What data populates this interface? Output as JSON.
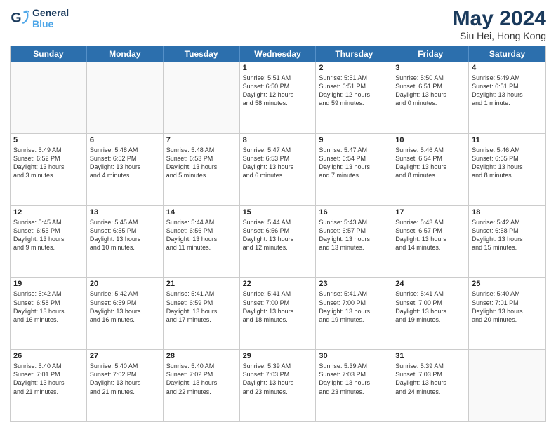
{
  "logo": {
    "line1": "General",
    "line2": "Blue"
  },
  "title": "May 2024",
  "subtitle": "Siu Hei, Hong Kong",
  "days_of_week": [
    "Sunday",
    "Monday",
    "Tuesday",
    "Wednesday",
    "Thursday",
    "Friday",
    "Saturday"
  ],
  "weeks": [
    [
      {
        "day": "",
        "empty": true
      },
      {
        "day": "",
        "empty": true
      },
      {
        "day": "",
        "empty": true
      },
      {
        "day": "1",
        "lines": [
          "Sunrise: 5:51 AM",
          "Sunset: 6:50 PM",
          "Daylight: 12 hours",
          "and 58 minutes."
        ]
      },
      {
        "day": "2",
        "lines": [
          "Sunrise: 5:51 AM",
          "Sunset: 6:51 PM",
          "Daylight: 12 hours",
          "and 59 minutes."
        ]
      },
      {
        "day": "3",
        "lines": [
          "Sunrise: 5:50 AM",
          "Sunset: 6:51 PM",
          "Daylight: 13 hours",
          "and 0 minutes."
        ]
      },
      {
        "day": "4",
        "lines": [
          "Sunrise: 5:49 AM",
          "Sunset: 6:51 PM",
          "Daylight: 13 hours",
          "and 1 minute."
        ]
      }
    ],
    [
      {
        "day": "5",
        "lines": [
          "Sunrise: 5:49 AM",
          "Sunset: 6:52 PM",
          "Daylight: 13 hours",
          "and 3 minutes."
        ]
      },
      {
        "day": "6",
        "lines": [
          "Sunrise: 5:48 AM",
          "Sunset: 6:52 PM",
          "Daylight: 13 hours",
          "and 4 minutes."
        ]
      },
      {
        "day": "7",
        "lines": [
          "Sunrise: 5:48 AM",
          "Sunset: 6:53 PM",
          "Daylight: 13 hours",
          "and 5 minutes."
        ]
      },
      {
        "day": "8",
        "lines": [
          "Sunrise: 5:47 AM",
          "Sunset: 6:53 PM",
          "Daylight: 13 hours",
          "and 6 minutes."
        ]
      },
      {
        "day": "9",
        "lines": [
          "Sunrise: 5:47 AM",
          "Sunset: 6:54 PM",
          "Daylight: 13 hours",
          "and 7 minutes."
        ]
      },
      {
        "day": "10",
        "lines": [
          "Sunrise: 5:46 AM",
          "Sunset: 6:54 PM",
          "Daylight: 13 hours",
          "and 8 minutes."
        ]
      },
      {
        "day": "11",
        "lines": [
          "Sunrise: 5:46 AM",
          "Sunset: 6:55 PM",
          "Daylight: 13 hours",
          "and 8 minutes."
        ]
      }
    ],
    [
      {
        "day": "12",
        "lines": [
          "Sunrise: 5:45 AM",
          "Sunset: 6:55 PM",
          "Daylight: 13 hours",
          "and 9 minutes."
        ]
      },
      {
        "day": "13",
        "lines": [
          "Sunrise: 5:45 AM",
          "Sunset: 6:55 PM",
          "Daylight: 13 hours",
          "and 10 minutes."
        ]
      },
      {
        "day": "14",
        "lines": [
          "Sunrise: 5:44 AM",
          "Sunset: 6:56 PM",
          "Daylight: 13 hours",
          "and 11 minutes."
        ]
      },
      {
        "day": "15",
        "lines": [
          "Sunrise: 5:44 AM",
          "Sunset: 6:56 PM",
          "Daylight: 13 hours",
          "and 12 minutes."
        ]
      },
      {
        "day": "16",
        "lines": [
          "Sunrise: 5:43 AM",
          "Sunset: 6:57 PM",
          "Daylight: 13 hours",
          "and 13 minutes."
        ]
      },
      {
        "day": "17",
        "lines": [
          "Sunrise: 5:43 AM",
          "Sunset: 6:57 PM",
          "Daylight: 13 hours",
          "and 14 minutes."
        ]
      },
      {
        "day": "18",
        "lines": [
          "Sunrise: 5:42 AM",
          "Sunset: 6:58 PM",
          "Daylight: 13 hours",
          "and 15 minutes."
        ]
      }
    ],
    [
      {
        "day": "19",
        "lines": [
          "Sunrise: 5:42 AM",
          "Sunset: 6:58 PM",
          "Daylight: 13 hours",
          "and 16 minutes."
        ]
      },
      {
        "day": "20",
        "lines": [
          "Sunrise: 5:42 AM",
          "Sunset: 6:59 PM",
          "Daylight: 13 hours",
          "and 16 minutes."
        ]
      },
      {
        "day": "21",
        "lines": [
          "Sunrise: 5:41 AM",
          "Sunset: 6:59 PM",
          "Daylight: 13 hours",
          "and 17 minutes."
        ]
      },
      {
        "day": "22",
        "lines": [
          "Sunrise: 5:41 AM",
          "Sunset: 7:00 PM",
          "Daylight: 13 hours",
          "and 18 minutes."
        ]
      },
      {
        "day": "23",
        "lines": [
          "Sunrise: 5:41 AM",
          "Sunset: 7:00 PM",
          "Daylight: 13 hours",
          "and 19 minutes."
        ]
      },
      {
        "day": "24",
        "lines": [
          "Sunrise: 5:41 AM",
          "Sunset: 7:00 PM",
          "Daylight: 13 hours",
          "and 19 minutes."
        ]
      },
      {
        "day": "25",
        "lines": [
          "Sunrise: 5:40 AM",
          "Sunset: 7:01 PM",
          "Daylight: 13 hours",
          "and 20 minutes."
        ]
      }
    ],
    [
      {
        "day": "26",
        "lines": [
          "Sunrise: 5:40 AM",
          "Sunset: 7:01 PM",
          "Daylight: 13 hours",
          "and 21 minutes."
        ]
      },
      {
        "day": "27",
        "lines": [
          "Sunrise: 5:40 AM",
          "Sunset: 7:02 PM",
          "Daylight: 13 hours",
          "and 21 minutes."
        ]
      },
      {
        "day": "28",
        "lines": [
          "Sunrise: 5:40 AM",
          "Sunset: 7:02 PM",
          "Daylight: 13 hours",
          "and 22 minutes."
        ]
      },
      {
        "day": "29",
        "lines": [
          "Sunrise: 5:39 AM",
          "Sunset: 7:03 PM",
          "Daylight: 13 hours",
          "and 23 minutes."
        ]
      },
      {
        "day": "30",
        "lines": [
          "Sunrise: 5:39 AM",
          "Sunset: 7:03 PM",
          "Daylight: 13 hours",
          "and 23 minutes."
        ]
      },
      {
        "day": "31",
        "lines": [
          "Sunrise: 5:39 AM",
          "Sunset: 7:03 PM",
          "Daylight: 13 hours",
          "and 24 minutes."
        ]
      },
      {
        "day": "",
        "empty": true
      }
    ]
  ]
}
